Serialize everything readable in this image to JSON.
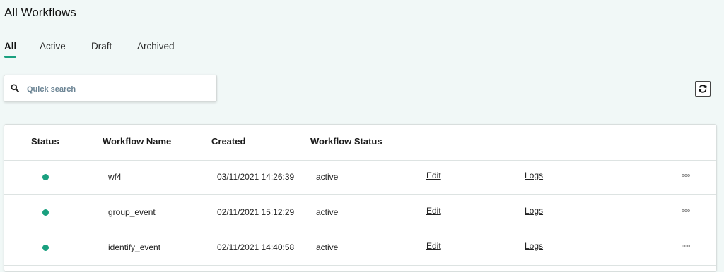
{
  "page": {
    "title": "All Workflows"
  },
  "tabs": [
    {
      "label": "All",
      "active": true
    },
    {
      "label": "Active",
      "active": false
    },
    {
      "label": "Draft",
      "active": false
    },
    {
      "label": "Archived",
      "active": false
    }
  ],
  "search": {
    "placeholder": "Quick search",
    "value": "",
    "icon": "search-icon"
  },
  "toolbar": {
    "refresh_icon": "refresh-icon"
  },
  "table": {
    "headers": {
      "status": "Status",
      "name": "Workflow Name",
      "created": "Created",
      "workflow_status": "Workflow Status"
    },
    "rows": [
      {
        "status_color": "#1aa07f",
        "name": "wf4",
        "created": "03/11/2021 14:26:39",
        "workflow_status": "active",
        "edit": "Edit",
        "logs": "Logs"
      },
      {
        "status_color": "#1aa07f",
        "name": "group_event",
        "created": "02/11/2021 15:12:29",
        "workflow_status": "active",
        "edit": "Edit",
        "logs": "Logs"
      },
      {
        "status_color": "#1aa07f",
        "name": "identify_event",
        "created": "02/11/2021 14:40:58",
        "workflow_status": "active",
        "edit": "Edit",
        "logs": "Logs"
      }
    ]
  },
  "colors": {
    "accent": "#1aa07f",
    "background": "#f1f8f7"
  }
}
